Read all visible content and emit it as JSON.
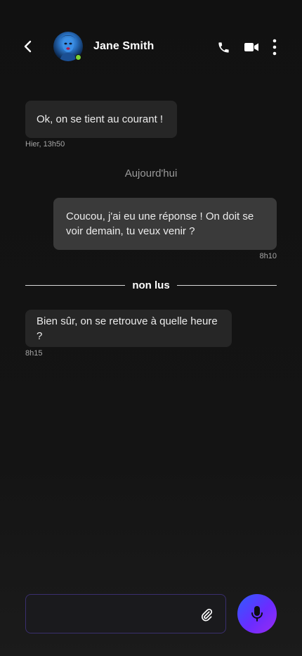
{
  "header": {
    "contact_name": "Jane Smith",
    "online": true,
    "icons": {
      "back": "chevron-left-icon",
      "call": "phone-icon",
      "video": "video-camera-icon",
      "more": "more-vertical-icon"
    }
  },
  "messages": [
    {
      "direction": "received",
      "text": "Ok, on se tient au courant !",
      "time": "Hier, 13h50"
    },
    {
      "direction": "sent",
      "text": "Coucou, j'ai eu une réponse ! On doit se voir demain, tu veux venir ?",
      "time": "8h10"
    },
    {
      "direction": "received",
      "text": "Bien sûr, on se retrouve à quelle heure ?",
      "time": "8h15"
    }
  ],
  "separators": {
    "day": "Aujourd'hui",
    "unread": "non lus"
  },
  "composer": {
    "placeholder": "",
    "value": "",
    "attach_icon": "paperclip-icon",
    "mic_icon": "microphone-icon"
  },
  "colors": {
    "background": "#111111",
    "bubble_received": "#262626",
    "bubble_sent": "#3a3a3a",
    "accent_start": "#2f5cff",
    "accent_end": "#9a2bf0",
    "online": "#7bd234"
  }
}
